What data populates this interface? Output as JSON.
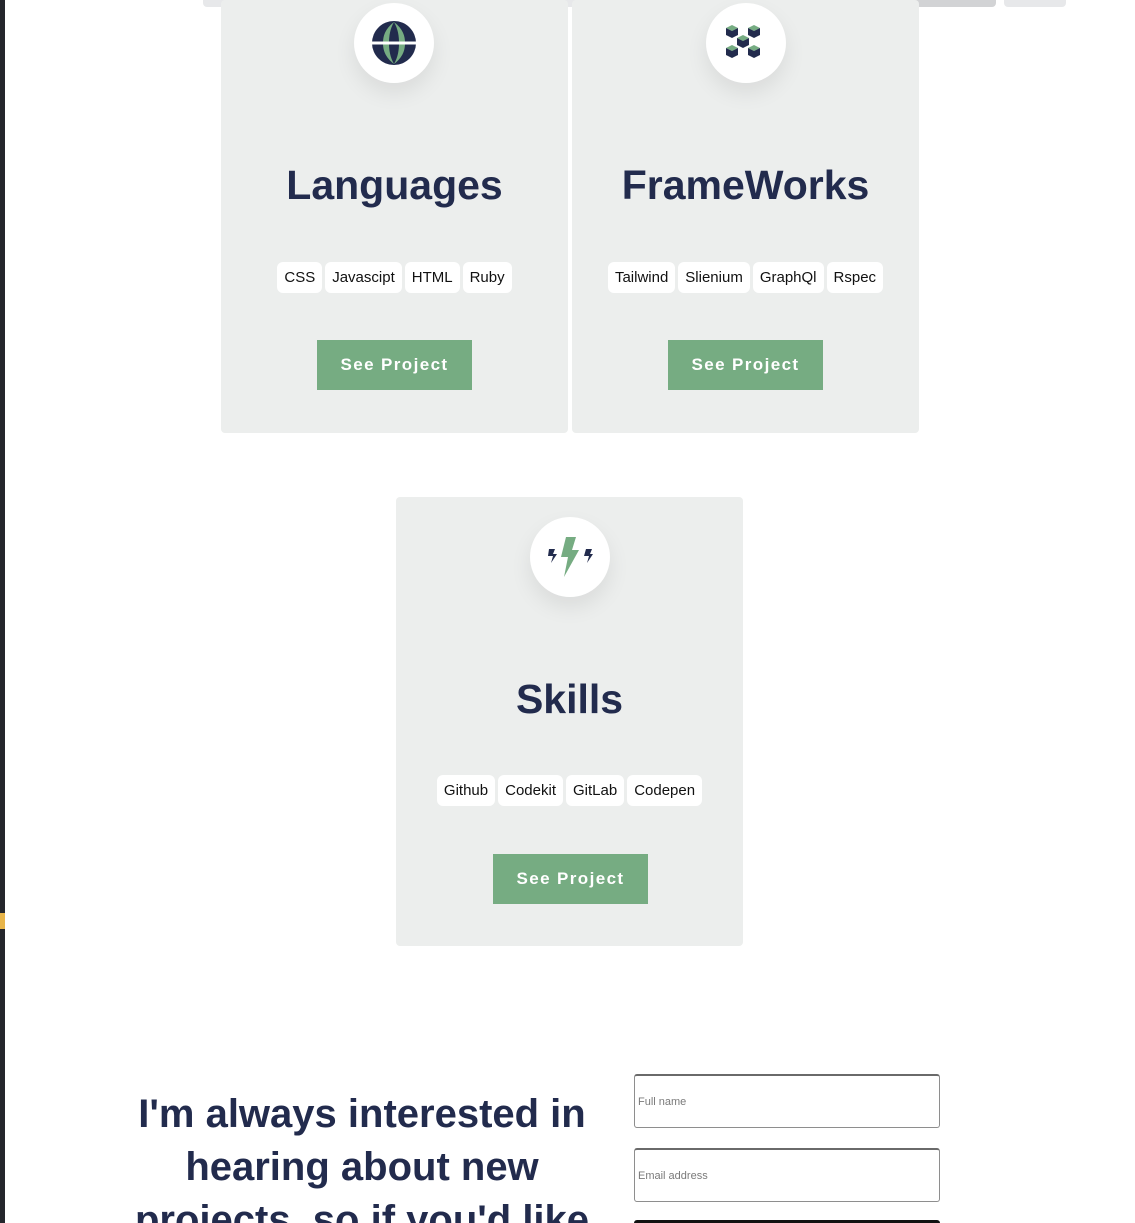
{
  "cards": [
    {
      "title": "Languages",
      "icon": "globe-icon",
      "tags": [
        "CSS",
        "Javascipt",
        "HTML",
        "Ruby"
      ],
      "button": "See Project"
    },
    {
      "title": "FrameWorks",
      "icon": "cubes-icon",
      "tags": [
        "Tailwind",
        "Slienium",
        "GraphQl",
        "Rspec"
      ],
      "button": "See Project"
    },
    {
      "title": "Skills",
      "icon": "lightning-icon",
      "tags": [
        "Github",
        "Codekit",
        "GitLab",
        "Codepen"
      ],
      "button": "See Project"
    }
  ],
  "contact": {
    "heading": "I'm always interested in hearing about new projects, so if you'd like",
    "full_name_placeholder": "Full name",
    "email_placeholder": "Email address"
  },
  "colors": {
    "accent": "#76ac82",
    "heading": "#222b4d",
    "card_bg": "#eceeed"
  }
}
